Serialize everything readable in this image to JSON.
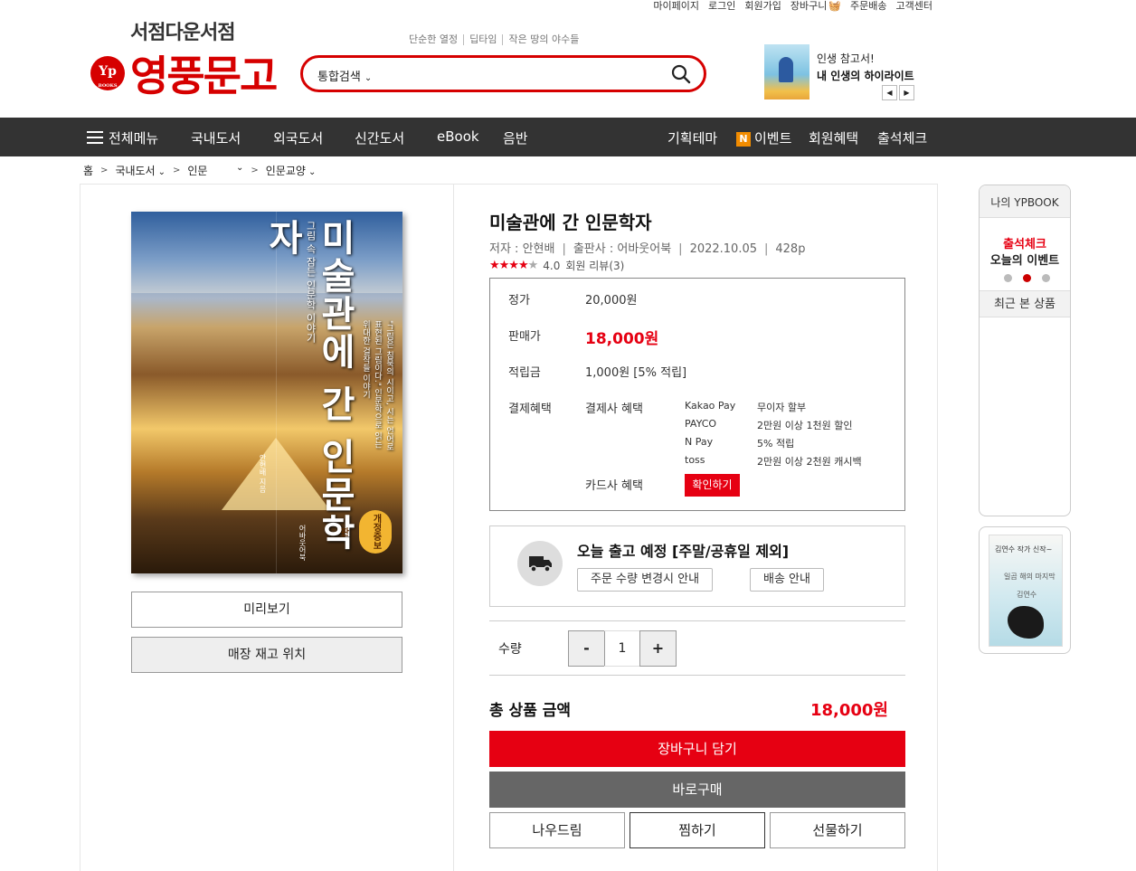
{
  "util_links": [
    "마이페이지",
    "로그인",
    "회원가입",
    "장바구니",
    "주문배송",
    "고객센터"
  ],
  "logo": {
    "tagline": "서점다운서점",
    "mark": "Yp",
    "mark_sub": "BOOKS",
    "name": "영풍문고"
  },
  "search": {
    "keywords": [
      "단순한 열정",
      "딥타임",
      "작은 땅의 야수들"
    ],
    "scope": "통합검색",
    "placeholder": ""
  },
  "banner": {
    "line1": "인생 참고서!",
    "line2": "내 인생의 하이라이트",
    "prev": "◀",
    "next": "▶"
  },
  "nav": {
    "menu_label": "전체메뉴",
    "left": [
      "국내도서",
      "외국도서",
      "신간도서",
      "eBook",
      "음반"
    ],
    "right": [
      "기획테마",
      "이벤트",
      "회원혜택",
      "출석체크"
    ],
    "event_badge": "N"
  },
  "breadcrumb": [
    "홈",
    "국내도서",
    "인문",
    "인문교양"
  ],
  "cover": {
    "title": "미술관에 간 인문학자",
    "subtitle": "그림 속 잠든 인문학 이야기",
    "quote": "\"그림은 침묵의 시이고, 시는 언어로 표현된 그림이다.\" 인문학으로 읽는 위대한 걸작들 이야기",
    "badge": "개정증보판",
    "author": "안현배 지음",
    "publisher": "어바웃어북"
  },
  "buttons": {
    "preview": "미리보기",
    "store_stock": "매장 재고 위치"
  },
  "product": {
    "title": "미술관에 간 인문학자",
    "author": "저자 : 안현배",
    "publisher": "출판사 : 어바웃어북",
    "date": "2022.10.05",
    "pages": "428p",
    "rating": 4.0,
    "rating_text": "4.0",
    "review": "회원 리뷰(3)"
  },
  "price": {
    "list_label": "정가",
    "list_value": "20,000원",
    "sale_label": "판매가",
    "sale_value": "18,000원",
    "point_label": "적립금",
    "point_value": "1,000원 [5% 적립]",
    "benefit_label": "결제혜택",
    "payco_label": "결제사 혜택",
    "payments": [
      {
        "name": "Kakao Pay",
        "desc": "무이자 할부"
      },
      {
        "name": "PAYCO",
        "desc": "2만원 이상 1천원 할인"
      },
      {
        "name": "N Pay",
        "desc": "5% 적립"
      },
      {
        "name": "toss",
        "desc": "2만원 이상 2천원 캐시백"
      }
    ],
    "card_label": "카드사 혜택",
    "card_button": "확인하기"
  },
  "shipping": {
    "title": "오늘 출고 예정 [주말/공휴일 제외]",
    "qty_info": "주문 수량 변경시 안내",
    "delivery_info": "배송 안내"
  },
  "quantity": {
    "label": "수량",
    "minus": "-",
    "value": "1",
    "plus": "+"
  },
  "total": {
    "label": "총 상품 금액",
    "value": "18,000원"
  },
  "actions": {
    "cart": "장바구니 담기",
    "buy": "바로구매",
    "nowdream": "나우드림",
    "wish": "찜하기",
    "gift": "선물하기"
  },
  "sidebar": {
    "header": "나의 YPBOOK",
    "event_line1": "출석체크",
    "event_line2": "오늘의 이벤트",
    "recent": "최근 본 상품",
    "ad_caption": "김연수 작가 신작~",
    "ad_title": "일곱 해의 마지막",
    "ad_author": "김연수"
  },
  "colors": {
    "accent": "#e60012",
    "nav_bg": "#333333",
    "buy_bg": "#666666"
  }
}
